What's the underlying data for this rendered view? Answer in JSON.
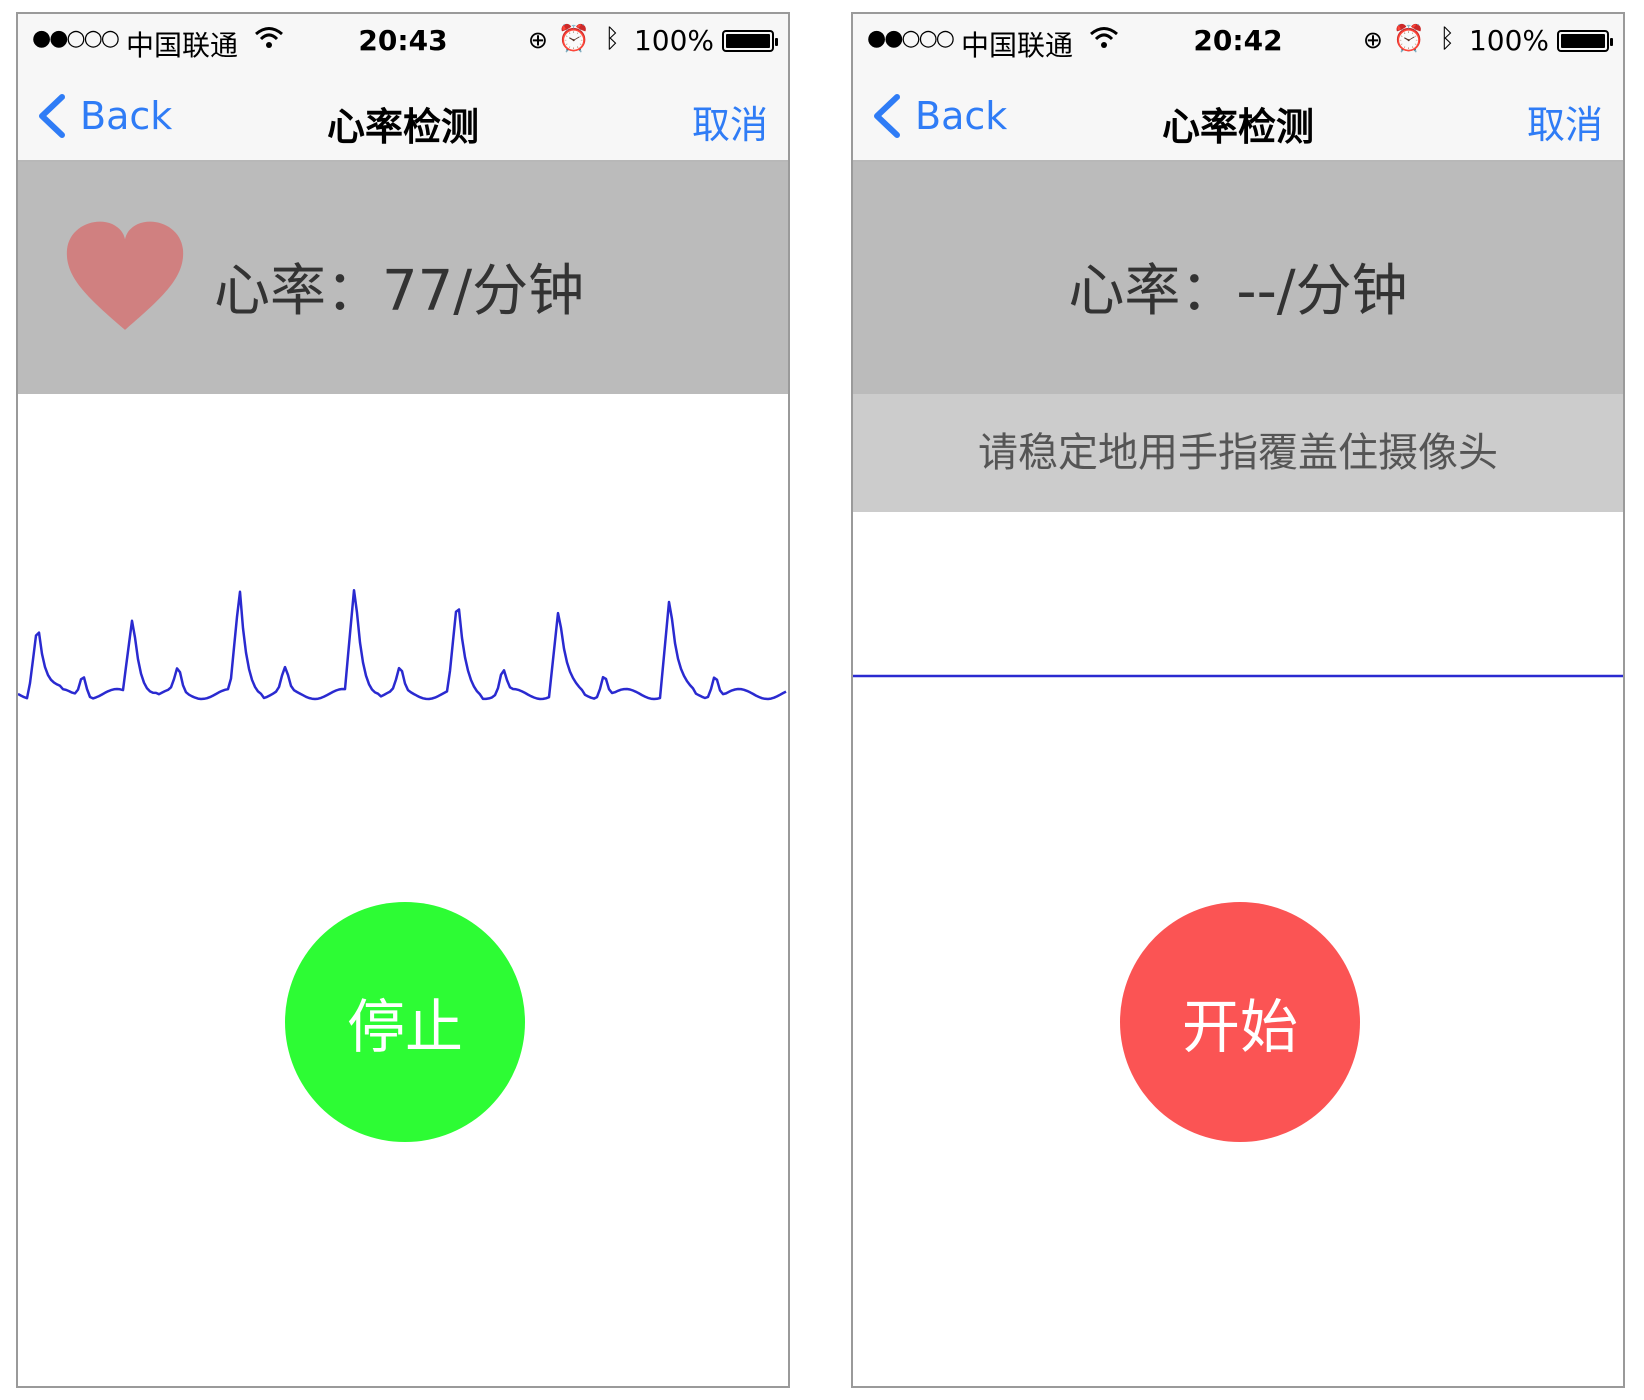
{
  "screens": [
    {
      "status_bar": {
        "signal": "●●○○○",
        "carrier": "中国联通",
        "time": "20:43",
        "battery": "100%"
      },
      "nav": {
        "back_label": "Back",
        "title": "心率检测",
        "cancel_label": "取消"
      },
      "heart_rate": {
        "text": "心率：77/分钟",
        "value": "77",
        "icon": "heart-icon",
        "icon_color": "#d08080"
      },
      "waveform": {
        "color": "#2a2ad0",
        "state": "active"
      },
      "action_button": {
        "label": "停止",
        "color": "#2dfc34"
      }
    },
    {
      "status_bar": {
        "signal": "●●○○○",
        "carrier": "中国联通",
        "time": "20:42",
        "battery": "100%"
      },
      "nav": {
        "back_label": "Back",
        "title": "心率检测",
        "cancel_label": "取消"
      },
      "heart_rate": {
        "text": "心率：--/分钟",
        "value": "--"
      },
      "hint": "请稳定地用手指覆盖住摄像头",
      "waveform": {
        "color": "#2a2ad0",
        "state": "flat"
      },
      "action_button": {
        "label": "开始",
        "color": "#fb5454"
      }
    }
  ]
}
